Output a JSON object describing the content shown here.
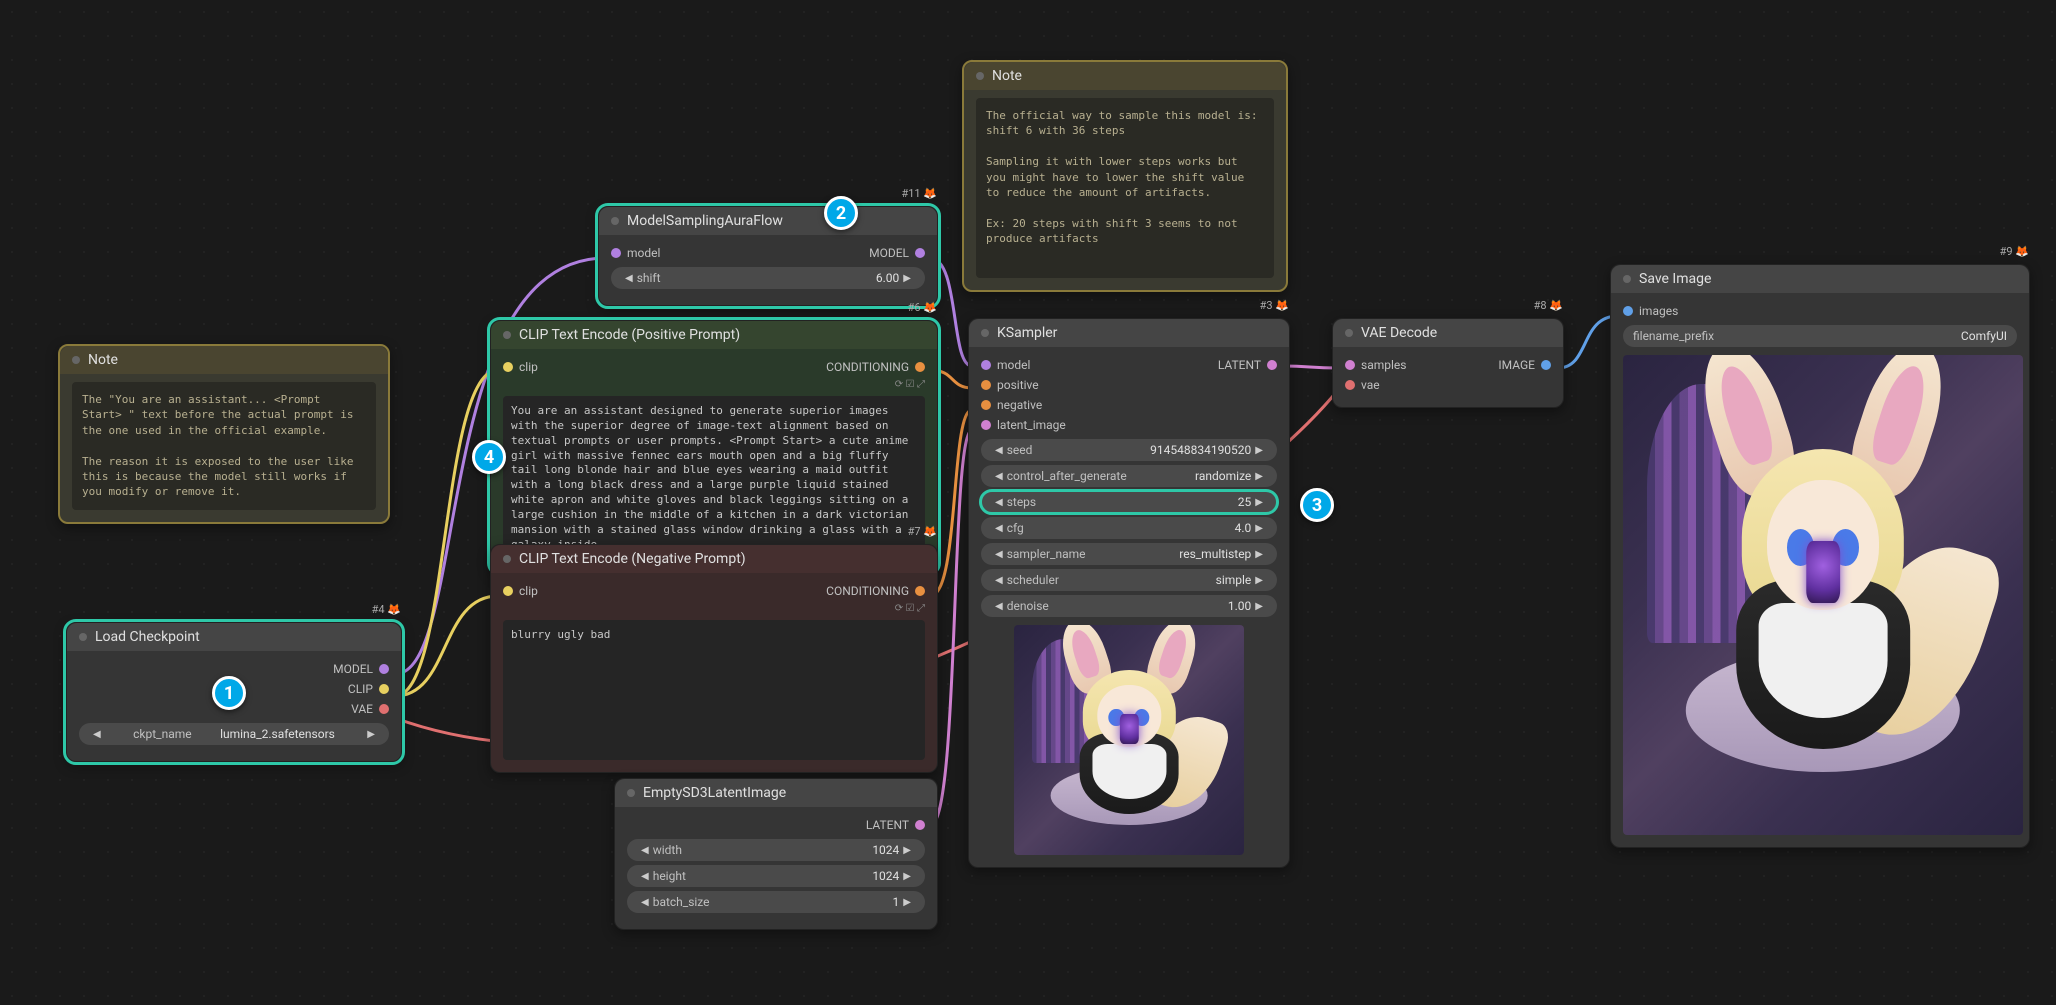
{
  "notes": {
    "left": {
      "title": "Note",
      "text": "The \"You are an assistant... <Prompt Start> \" text before the actual prompt is the one used in the official example.\n\nThe reason it is exposed to the user like this is because the model still works if you modify or remove it."
    },
    "top": {
      "title": "Note",
      "text": "The official way to sample this model is: shift 6 with 36 steps\n\nSampling it with lower steps works but you might have to lower the shift value to reduce the amount of artifacts.\n\nEx: 20 steps with shift 3 seems to not produce artifacts"
    }
  },
  "load_checkpoint": {
    "title": "Load Checkpoint",
    "tag": "#4 🦊",
    "outputs": {
      "model": "MODEL",
      "clip": "CLIP",
      "vae": "VAE"
    },
    "param_key": "ckpt_name",
    "param_val": "lumina_2.safetensors"
  },
  "model_sampling": {
    "title": "ModelSamplingAuraFlow",
    "tag": "#11 🦊",
    "in_label": "model",
    "out_label": "MODEL",
    "param_key": "shift",
    "param_val": "6.00"
  },
  "clip_pos": {
    "title": "CLIP Text Encode (Positive Prompt)",
    "tag": "#6 🦊",
    "in_label": "clip",
    "out_label": "CONDITIONING",
    "text": "You are an assistant designed to generate superior images with the superior degree of image-text alignment based on textual prompts or user prompts. <Prompt Start> a cute anime girl with massive fennec ears mouth open and a big fluffy tail long blonde hair and blue eyes wearing a maid outfit with a long black dress and a large purple liquid stained white apron and white gloves and black leggings sitting on a large cushion in the middle of a kitchen in a dark victorian mansion with a stained glass window drinking a glass with a galaxy inside"
  },
  "clip_neg": {
    "title": "CLIP Text Encode (Negative Prompt)",
    "tag": "#7 🦊",
    "in_label": "clip",
    "out_label": "CONDITIONING",
    "text": "blurry ugly bad"
  },
  "empty_latent": {
    "title": "EmptySD3LatentImage",
    "tag": "",
    "out_label": "LATENT",
    "width_key": "width",
    "width_val": "1024",
    "height_key": "height",
    "height_val": "1024",
    "batch_key": "batch_size",
    "batch_val": "1"
  },
  "ksampler": {
    "title": "KSampler",
    "tag": "#3 🦊",
    "inputs": {
      "model": "model",
      "positive": "positive",
      "negative": "negative",
      "latent_image": "latent_image"
    },
    "out_label": "LATENT",
    "seed_key": "seed",
    "seed_val": "914548834190520",
    "ctrl_key": "control_after_generate",
    "ctrl_val": "randomize",
    "steps_key": "steps",
    "steps_val": "25",
    "cfg_key": "cfg",
    "cfg_val": "4.0",
    "sampler_key": "sampler_name",
    "sampler_val": "res_multistep",
    "sched_key": "scheduler",
    "sched_val": "simple",
    "denoise_key": "denoise",
    "denoise_val": "1.00"
  },
  "vae_decode": {
    "title": "VAE Decode",
    "tag": "#8 🦊",
    "in_samples": "samples",
    "in_vae": "vae",
    "out_label": "IMAGE"
  },
  "save_image": {
    "title": "Save Image",
    "tag": "#9 🦊",
    "in_label": "images",
    "prefix_key": "filename_prefix",
    "prefix_val": "ComfyUI"
  },
  "badges": {
    "b1": "1",
    "b2": "2",
    "b3": "3",
    "b4": "4"
  }
}
